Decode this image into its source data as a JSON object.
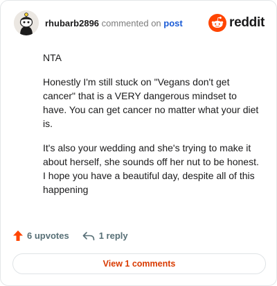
{
  "header": {
    "username": "rhubarb2896",
    "action": "commented on",
    "post_link": "post",
    "logo_text": "reddit"
  },
  "comment": {
    "paragraphs": [
      "NTA",
      "Honestly I'm still stuck on \"Vegans don't get cancer\" that is a VERY dangerous mindset to have. You can get cancer no matter what your diet is.",
      "It's also your wedding and she's trying to make it about herself, she sounds off her nut to be honest. I hope you have a beautiful day, despite all of this happening"
    ]
  },
  "footer": {
    "upvotes_label": "6 upvotes",
    "replies_label": "1 reply",
    "view_comments_label": "View 1 comments"
  },
  "colors": {
    "accent": "#ff4500",
    "link": "#1a5bd6",
    "view_button_text": "#d93a00"
  },
  "icons": {
    "avatar": "snoo-avatar",
    "logo": "reddit-snoo-icon",
    "upvote": "upvote-arrow-icon",
    "reply": "reply-arrow-icon"
  }
}
